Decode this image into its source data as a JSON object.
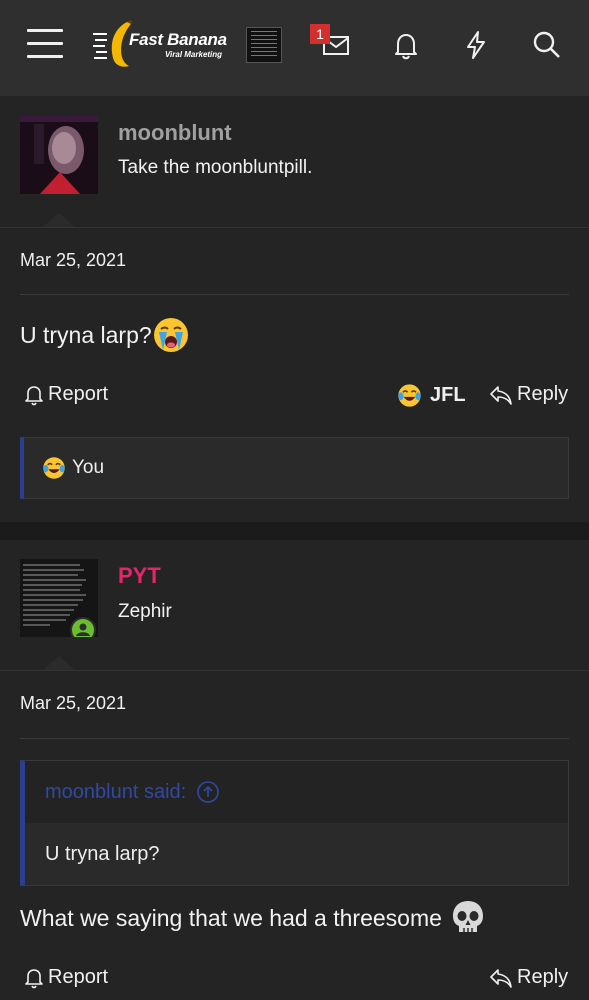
{
  "header": {
    "logo_title": "Fast Banana",
    "logo_subtitle": "Viral Marketing",
    "inbox_badge": "1",
    "icons": [
      "menu-icon",
      "inbox-icon",
      "bell-icon",
      "bolt-icon",
      "search-icon"
    ],
    "brand_color": "#f5b800"
  },
  "posts": [
    {
      "username": "moonblunt",
      "user_title": "Take the moonbluntpill.",
      "username_color": "#a0a0a0",
      "date": "Mar 25, 2021",
      "message": "U tryna larp?",
      "message_emoji": "crying-face",
      "report_label": "Report",
      "reaction_label": "JFL",
      "reply_label": "Reply",
      "reactions_summary": "You"
    },
    {
      "username": "PYT",
      "user_title": "Zephir",
      "username_color": "#e5256b",
      "date": "Mar 25, 2021",
      "quote_author": "moonblunt said:",
      "quote_text": "U tryna larp?",
      "message": "What we saying that we had a threesome",
      "message_emoji": "skull",
      "report_label": "Report",
      "reply_label": "Reply"
    }
  ]
}
